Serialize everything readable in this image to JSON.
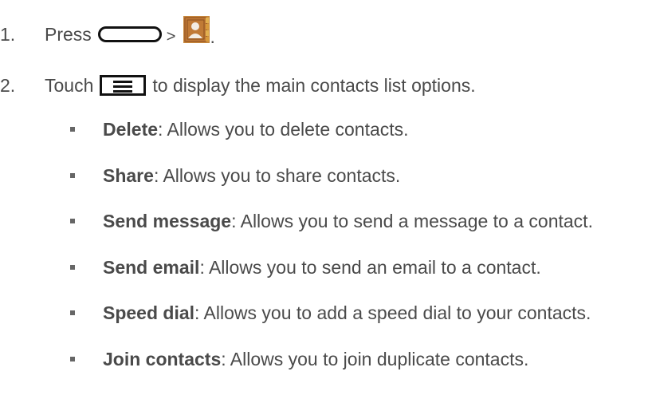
{
  "steps": [
    {
      "number": "1.",
      "press_text": "Press",
      "separator": ">",
      "trailing": ".",
      "home_key_icon": "home-key-icon",
      "contacts_icon": "contacts-app-icon"
    },
    {
      "number": "2.",
      "touch_text": "Touch",
      "menu_key_icon": "menu-key-icon",
      "rest_text": "to display the main contacts list options."
    }
  ],
  "options": [
    {
      "term": "Delete",
      "desc": ": Allows you to delete contacts."
    },
    {
      "term": "Share",
      "desc": ": Allows you to share contacts."
    },
    {
      "term": "Send message",
      "desc": ": Allows you to send a message to a contact."
    },
    {
      "term": "Send email",
      "desc": ": Allows you to send an email to a contact."
    },
    {
      "term": "Speed dial",
      "desc": ": Allows you to add a speed dial to your contacts."
    },
    {
      "term": "Join contacts",
      "desc": ": Allows you to join duplicate contacts."
    }
  ],
  "colors": {
    "text": "#4a4a4a",
    "icon_outline": "#111111",
    "contacts_icon_brown": "#b7702f",
    "contacts_icon_tab": "#d6a248"
  }
}
